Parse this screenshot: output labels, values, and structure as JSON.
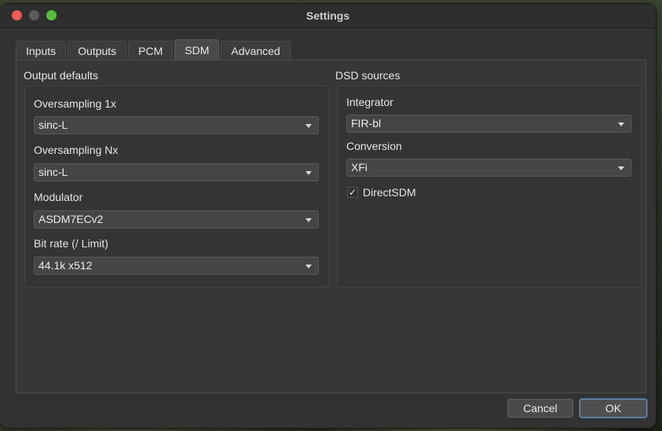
{
  "window": {
    "title": "Settings"
  },
  "tabs": [
    {
      "label": "Inputs",
      "active": false
    },
    {
      "label": "Outputs",
      "active": false
    },
    {
      "label": "PCM",
      "active": false
    },
    {
      "label": "SDM",
      "active": true
    },
    {
      "label": "Advanced",
      "active": false
    }
  ],
  "output_defaults": {
    "title": "Output defaults",
    "fields": [
      {
        "label": "Oversampling 1x",
        "value": "sinc-L"
      },
      {
        "label": "Oversampling Nx",
        "value": "sinc-L"
      },
      {
        "label": "Modulator",
        "value": "ASDM7ECv2"
      },
      {
        "label": "Bit rate (/ Limit)",
        "value": "44.1k x512"
      }
    ]
  },
  "dsd_sources": {
    "title": "DSD sources",
    "fields": [
      {
        "label": "Integrator",
        "value": "FIR-bl"
      },
      {
        "label": "Conversion",
        "value": "XFi"
      }
    ],
    "direct_sdm": {
      "label": "DirectSDM",
      "checked": true,
      "checkmark": "✓"
    }
  },
  "buttons": {
    "cancel": "Cancel",
    "ok": "OK"
  },
  "colors": {
    "close": "#ee5c52",
    "minimize": "#5c5c5c",
    "maximize": "#58c03d",
    "ok_focus": "#6f8fb8"
  }
}
